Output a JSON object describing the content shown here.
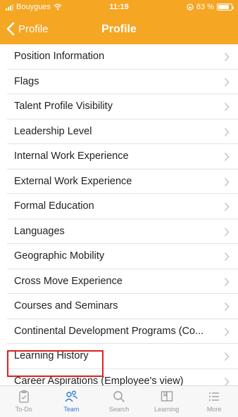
{
  "status_bar": {
    "carrier": "Bouygues",
    "time": "11:19",
    "battery_text": "83 %",
    "battery_level": 0.83
  },
  "nav": {
    "back_label": "Profile",
    "title": "Profile"
  },
  "items": [
    {
      "label": "Position Information"
    },
    {
      "label": "Flags"
    },
    {
      "label": "Talent Profile Visibility"
    },
    {
      "label": "Leadership Level"
    },
    {
      "label": "Internal Work Experience"
    },
    {
      "label": "External Work Experience"
    },
    {
      "label": "Formal Education"
    },
    {
      "label": "Languages"
    },
    {
      "label": "Geographic Mobility"
    },
    {
      "label": "Cross Move Experience"
    },
    {
      "label": "Courses and Seminars"
    },
    {
      "label": "Continental Development Programs (Co..."
    },
    {
      "label": "Learning History"
    },
    {
      "label": "Career Aspirations (Employee's view)"
    }
  ],
  "tabs": [
    {
      "label": "To-Do",
      "icon": "todo-icon",
      "active": false
    },
    {
      "label": "Team",
      "icon": "team-icon",
      "active": true
    },
    {
      "label": "Search",
      "icon": "search-icon",
      "active": false
    },
    {
      "label": "Learning",
      "icon": "book-icon",
      "active": false
    },
    {
      "label": "More",
      "icon": "more-icon",
      "active": false
    }
  ],
  "colors": {
    "header": "#f5a623",
    "active_tab": "#2a7bd4",
    "highlight": "#e02020"
  }
}
